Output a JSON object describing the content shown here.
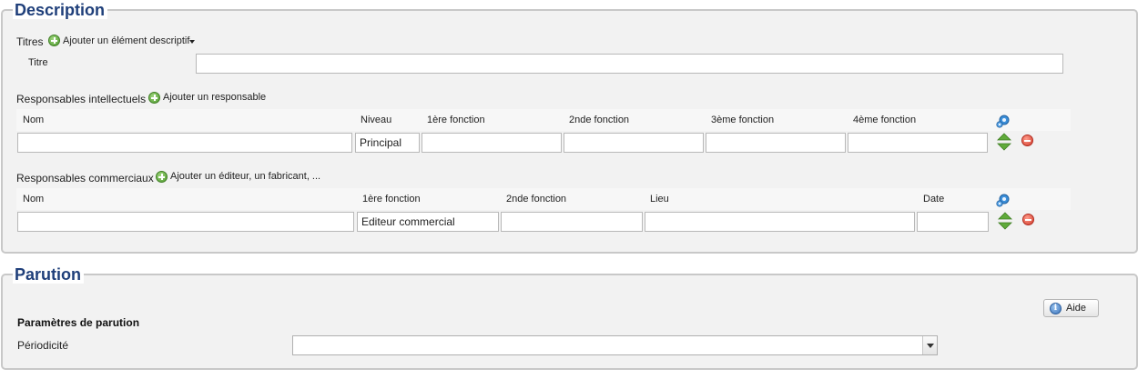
{
  "description": {
    "legend": "Description",
    "titres": {
      "label": "Titres",
      "add_label": "Ajouter un élément descriptif",
      "titre_label": "Titre",
      "titre_value": ""
    },
    "intellectuels": {
      "label": "Responsables intellectuels",
      "add_label": "Ajouter un responsable",
      "headers": [
        "Nom",
        "Niveau",
        "1ère fonction",
        "2nde fonction",
        "3ème fonction",
        "4ème fonction"
      ],
      "row": [
        "",
        "Principal",
        "",
        "",
        "",
        ""
      ]
    },
    "commerciaux": {
      "label": "Responsables commerciaux",
      "add_label": "Ajouter un éditeur, un fabricant, ...",
      "headers": [
        "Nom",
        "1ère fonction",
        "2nde fonction",
        "Lieu",
        "Date"
      ],
      "row": [
        "",
        "Editeur commercial",
        "",
        "",
        ""
      ]
    }
  },
  "parution": {
    "legend": "Parution",
    "help_label": "Aide",
    "section_title": "Paramètres de parution",
    "periodicite_label": "Périodicité",
    "periodicite_value": ""
  },
  "icons": {
    "add": "plus-circle-icon",
    "remove": "minus-circle-icon",
    "settings": "gear-icon",
    "reorder": "up-down-arrows-icon",
    "help": "info-icon",
    "dropdown": "caret-down-icon"
  },
  "colors": {
    "legend_text": "#1f3f7a",
    "add_icon": "#4f9a2e",
    "remove_icon": "#d23c2c"
  }
}
